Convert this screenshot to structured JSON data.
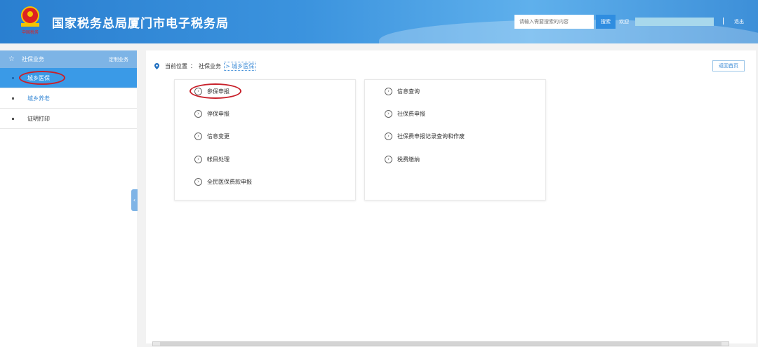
{
  "header": {
    "title": "国家税务总局厦门市电子税务局",
    "search_placeholder": "请输入需要搜索的内容",
    "search_button": "搜索",
    "welcome": "欢迎",
    "logout": "退出"
  },
  "sidebar": {
    "section": "社保业务",
    "customize": "定制业务",
    "items": [
      {
        "label": "城乡医保"
      },
      {
        "label": "城乡养老"
      },
      {
        "label": "证明打印"
      }
    ]
  },
  "breadcrumb": {
    "label": "当前位置",
    "sep": "：",
    "parent": "社保业务",
    "current": "> 城乡医保"
  },
  "back_home": "返回首页",
  "left_panel": [
    "参保申报",
    "停保申报",
    "信息变更",
    "帐目处理",
    "全民医保费款申报"
  ],
  "right_panel": [
    "信息查询",
    "社保费申报",
    "社保费申报记录查询和作废",
    "税费缴纳"
  ],
  "colors": {
    "accent": "#3a9ae7",
    "highlight_oval": "#c8202a"
  }
}
